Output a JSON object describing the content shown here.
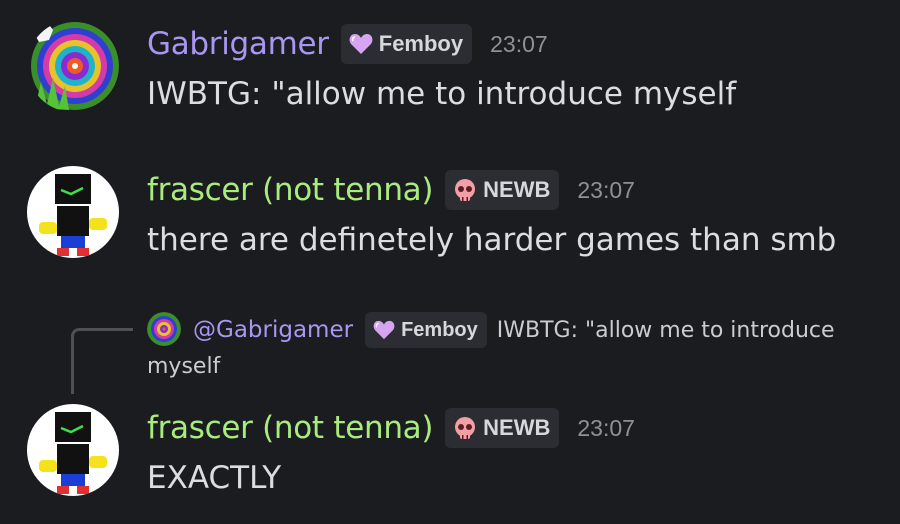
{
  "colors": {
    "background": "#1b1c20",
    "gabrigamer_name": "#a896f0",
    "frascer_name": "#a9ec7e",
    "tag_bg": "#2c2d33",
    "timestamp": "#8e9198"
  },
  "messages": [
    {
      "author": "Gabrigamer",
      "tag_icon": "purple-heart-icon",
      "tag": "Femboy",
      "time": "23:07",
      "text": "IWBTG: \"allow me to introduce myself"
    },
    {
      "author": "frascer (not tenna)",
      "tag_icon": "pink-skull-icon",
      "tag": "NEWB",
      "time": "23:07",
      "text": "there are definetely harder games than smb"
    },
    {
      "reply": {
        "mention": "@Gabrigamer",
        "tag_icon": "purple-heart-icon",
        "tag": "Femboy",
        "text_line1": "IWBTG: \"allow me to introduce",
        "text_line2": "myself"
      },
      "author": "frascer (not tenna)",
      "tag_icon": "pink-skull-icon",
      "tag": "NEWB",
      "time": "23:07",
      "text": "EXACTLY"
    }
  ]
}
